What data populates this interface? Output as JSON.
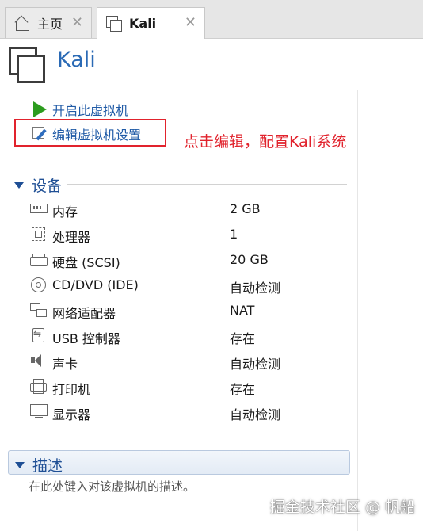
{
  "tabs": [
    {
      "label": "主页",
      "icon": "home-icon",
      "active": false
    },
    {
      "label": "Kali",
      "icon": "vm-icon",
      "active": true
    }
  ],
  "header": {
    "title": "Kali",
    "icon": "vm-icon"
  },
  "actions": {
    "start": {
      "label": "开启此虚拟机",
      "icon": "play-icon",
      "color": "#2c9c1e"
    },
    "edit": {
      "label": "编辑虚拟机设置",
      "icon": "edit-settings-icon"
    }
  },
  "annotation": {
    "text": "点击编辑，配置Kali系统",
    "color": "#e1232d"
  },
  "devices": {
    "title": "设备",
    "items": [
      {
        "name": "内存",
        "value": "2 GB",
        "icon": "memory-icon"
      },
      {
        "name": "处理器",
        "value": "1",
        "icon": "cpu-icon"
      },
      {
        "name": "硬盘 (SCSI)",
        "value": "20 GB",
        "icon": "disk-icon"
      },
      {
        "name": "CD/DVD (IDE)",
        "value": "自动检测",
        "icon": "cd-icon"
      },
      {
        "name": "网络适配器",
        "value": "NAT",
        "icon": "network-icon"
      },
      {
        "name": "USB 控制器",
        "value": "存在",
        "icon": "usb-icon"
      },
      {
        "name": "声卡",
        "value": "自动检测",
        "icon": "sound-icon"
      },
      {
        "name": "打印机",
        "value": "存在",
        "icon": "printer-icon"
      },
      {
        "name": "显示器",
        "value": "自动检测",
        "icon": "monitor-icon"
      }
    ]
  },
  "description": {
    "title": "描述",
    "placeholder": "在此处键入对该虚拟机的描述。"
  },
  "watermark": "掘金技术社区 @ 帆船",
  "colors": {
    "accent": "#2a6ab5",
    "link": "#1f5aa6",
    "annotation": "#e1232d"
  }
}
